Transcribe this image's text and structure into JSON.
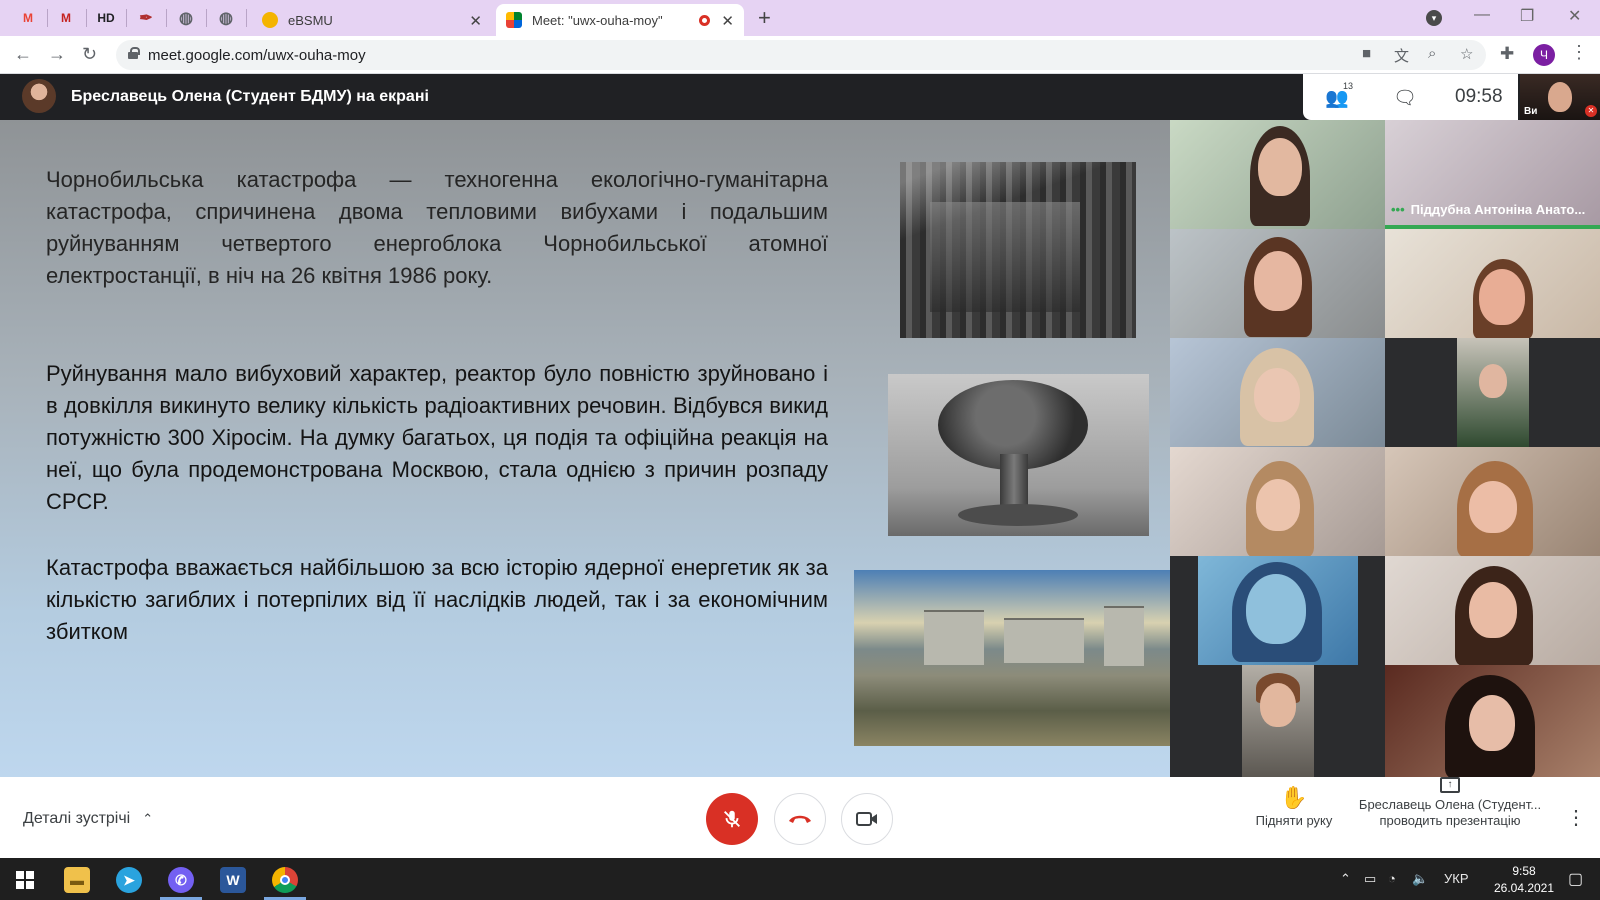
{
  "browser": {
    "pinned_tabs": [
      {
        "icon": "gmail-icon",
        "label": "M",
        "color": "#ea4335"
      },
      {
        "icon": "gmail-icon",
        "label": "M",
        "color": "#c5221f"
      },
      {
        "icon": "hd-icon",
        "label": "HD",
        "color": "#202124"
      },
      {
        "icon": "pen-icon",
        "label": "✒",
        "color": "#b03030"
      },
      {
        "icon": "globe-icon",
        "label": "◍",
        "color": "#5f6368"
      },
      {
        "icon": "globe-icon",
        "label": "◍",
        "color": "#5f6368"
      }
    ],
    "tabs": [
      {
        "title": "eBSMU",
        "active": false
      },
      {
        "title": "Meet: \"uwx-ouha-moy\"",
        "active": true
      }
    ],
    "new_tab_label": "+",
    "url": "meet.google.com/uwx-ouha-moy",
    "profile_initial": "Ч"
  },
  "meet": {
    "presenter_title": "Бреславець Олена (Студент БДМУ) на екрані",
    "participant_count": "13",
    "clock": "09:58",
    "self_label": "Ви",
    "slide": {
      "paragraphs": [
        "Чорнобильська катастрофа — техногенна екологічно-гуманітарна катастрофа, спричинена двома тепловими вибухами і подальшим руйнуванням четвертого енергоблока Чорнобильської атомної електростанції, в ніч на 26 квітня 1986 року.",
        "Руйнування мало вибуховий характер, реактор було повністю зруйновано і в довкілля викинуто велику кількість радіоактивних речовин. Відбувся викид потужністю 300 Хіросім. На думку багатьох, ця подія та офіційна реакція на неї, що була продемонстрована Москвою, стала однією з причин розпаду СРСР.",
        "Катастрофа вважається найбільшою за всю історію ядерної енергетик як за кількістю загиблих і потерпілих від її наслідків людей, так і за економічним збитком"
      ]
    },
    "participants": [
      {
        "name": ""
      },
      {
        "name": "Піддубна Антоніна Анато..."
      },
      {
        "name": ""
      },
      {
        "name": ""
      },
      {
        "name": ""
      },
      {
        "name": ""
      },
      {
        "name": ""
      },
      {
        "name": ""
      },
      {
        "name": ""
      },
      {
        "name": ""
      },
      {
        "name": ""
      },
      {
        "name": ""
      }
    ],
    "controls": {
      "meeting_details": "Деталі зустрічі",
      "raise_hand": "Підняти руку",
      "presenting_line1": "Бреславець Олена (Студент...",
      "presenting_line2": "проводить презентацію"
    }
  },
  "taskbar": {
    "apps": [
      {
        "icon": "file-explorer-icon",
        "color": "#f0c14b"
      },
      {
        "icon": "telegram-icon",
        "color": "#2aa3de"
      },
      {
        "icon": "viber-icon",
        "color": "#7360f2"
      },
      {
        "icon": "word-icon",
        "color": "#2b579a"
      },
      {
        "icon": "chrome-icon",
        "color": "#db4437"
      }
    ],
    "language": "УКР",
    "time": "9:58",
    "date": "26.04.2021"
  },
  "colors": {
    "tab_strip": "#e6d3f3",
    "meet_dark": "#202124",
    "mic_off_red": "#d93025",
    "speaking_green": "#34a853"
  }
}
